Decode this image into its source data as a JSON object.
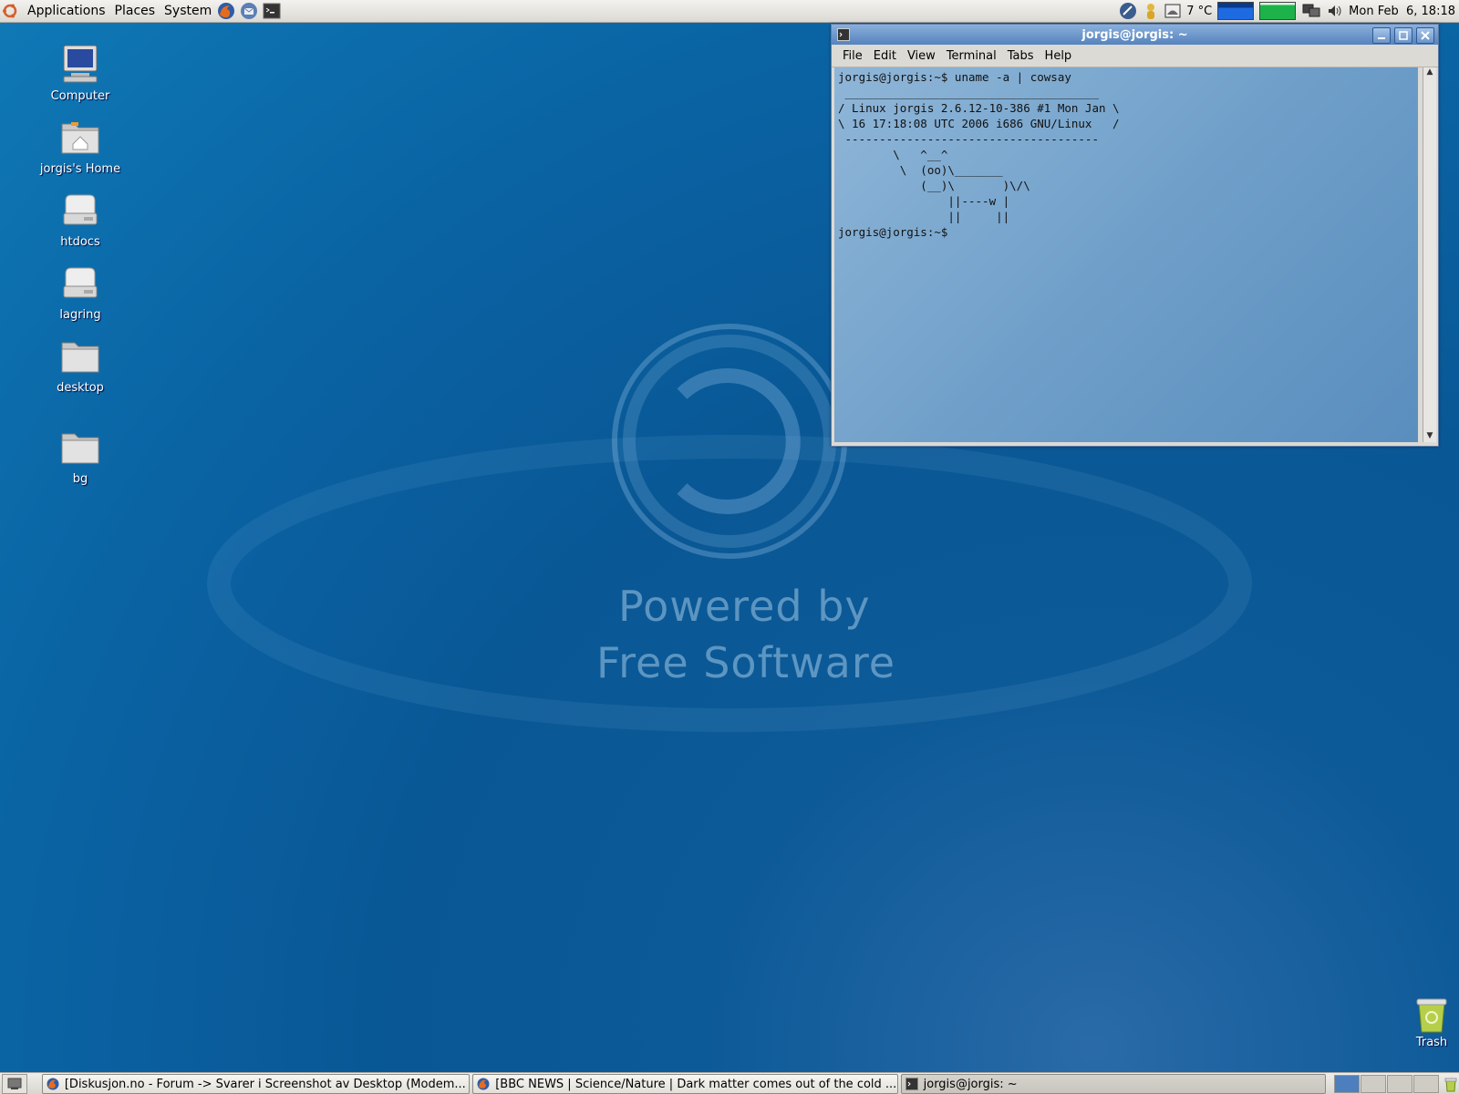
{
  "top_panel": {
    "menus": [
      "Applications",
      "Places",
      "System"
    ],
    "weather": "7 °C",
    "clock": "Mon Feb  6, 18:18"
  },
  "desktop_icons": [
    {
      "label": "Computer"
    },
    {
      "label": "jorgis's Home"
    },
    {
      "label": "htdocs"
    },
    {
      "label": "lagring"
    },
    {
      "label": "desktop"
    },
    {
      "label": "bg"
    }
  ],
  "wallpaper": {
    "line1": "Powered by",
    "line2": "Free Software"
  },
  "terminal": {
    "title": "jorgis@jorgis: ~",
    "menu": [
      "File",
      "Edit",
      "View",
      "Terminal",
      "Tabs",
      "Help"
    ],
    "content": "jorgis@jorgis:~$ uname -a | cowsay\n _____________________________________\n/ Linux jorgis 2.6.12-10-386 #1 Mon Jan \\\n\\ 16 17:18:08 UTC 2006 i686 GNU/Linux   /\n -------------------------------------\n        \\   ^__^\n         \\  (oo)\\_______\n            (__)\\       )\\/\\\n                ||----w |\n                ||     ||\njorgis@jorgis:~$"
  },
  "trash": {
    "label": "Trash"
  },
  "taskbar": [
    {
      "label": "[Diskusjon.no - Forum -> Svarer i Screenshot av Desktop (Modem..."
    },
    {
      "label": "[BBC NEWS | Science/Nature | Dark matter comes out of the cold ..."
    },
    {
      "label": "jorgis@jorgis: ~"
    }
  ]
}
